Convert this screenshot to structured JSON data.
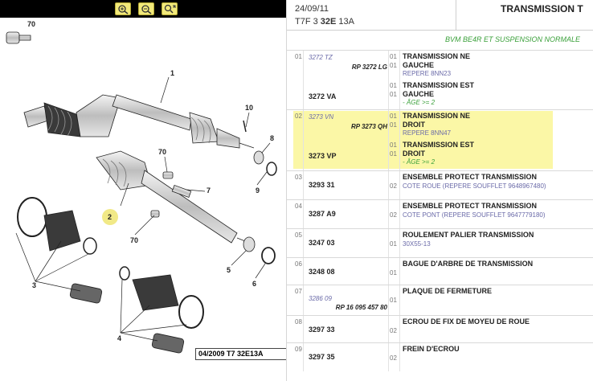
{
  "diagram": {
    "zoom_buttons": [
      {
        "name": "zoom-in-icon"
      },
      {
        "name": "zoom-out-icon"
      },
      {
        "name": "zoom-fit-icon"
      }
    ],
    "callouts": [
      "70",
      "1",
      "10",
      "8",
      "9",
      "70",
      "7",
      "2",
      "70",
      "3",
      "5",
      "6",
      "4"
    ],
    "reference": "04/2009  T7 32E13A"
  },
  "header": {
    "date": "24/09/11",
    "code_prefix": "T7F 3 ",
    "code_bold": "32E",
    "code_suffix": " 13A",
    "title": "TRANSMISSION T"
  },
  "variant": "BVM BE4R ET SUSPENSION NORMALE",
  "rows": [
    {
      "index": "01",
      "highlight": false,
      "lines": [
        {
          "old": "3272 TZ",
          "rp": "RP 3272 LG",
          "qty": "01",
          "desc": "TRANSMISSION NE",
          "desc_b": "GAUCHE",
          "desc_c": "REPERE 8NN23"
        },
        {
          "main": "3272 VA",
          "qty": "01",
          "desc": "TRANSMISSION EST",
          "desc_b": "GAUCHE",
          "note": "- ÂGE >= 2"
        }
      ]
    },
    {
      "index": "02",
      "highlight": true,
      "lines": [
        {
          "old": "3273 VN",
          "rp": "RP 3273 QH",
          "qty": "01",
          "desc": "TRANSMISSION NE",
          "desc_b": "DROIT",
          "desc_c": "REPERE 8NN47"
        },
        {
          "main": "3273 VP",
          "qty": "01",
          "desc": "TRANSMISSION EST",
          "desc_b": "DROIT",
          "note": "- ÂGE >= 2"
        }
      ]
    },
    {
      "index": "03",
      "main": "3293 31",
      "qty": "02",
      "desc": "ENSEMBLE PROTECT TRANSMISSION",
      "desc2": "COTE ROUE (REPERE SOUFFLET 9648967480)"
    },
    {
      "index": "04",
      "main": "3287 A9",
      "qty": "02",
      "desc": "ENSEMBLE PROTECT TRANSMISSION",
      "desc2": "COTE PONT (REPERE SOUFFLET 9647779180)"
    },
    {
      "index": "05",
      "main": "3247 03",
      "qty": "01",
      "desc": "ROULEMENT PALIER TRANSMISSION",
      "desc2": "30X55-13"
    },
    {
      "index": "06",
      "main": "3248 08",
      "qty": "01",
      "desc": "BAGUE D'ARBRE DE TRANSMISSION"
    },
    {
      "index": "07",
      "old": "3286 09",
      "rp": "RP 16 095 457 80",
      "qty": "01",
      "desc": "PLAQUE DE FERMETURE"
    },
    {
      "index": "08",
      "main": "3297 33",
      "qty": "02",
      "desc": "ECROU DE FIX DE MOYEU DE ROUE"
    },
    {
      "index": "09",
      "main": "3297 35",
      "qty": "02",
      "desc": "FREIN D'ECROU"
    }
  ]
}
